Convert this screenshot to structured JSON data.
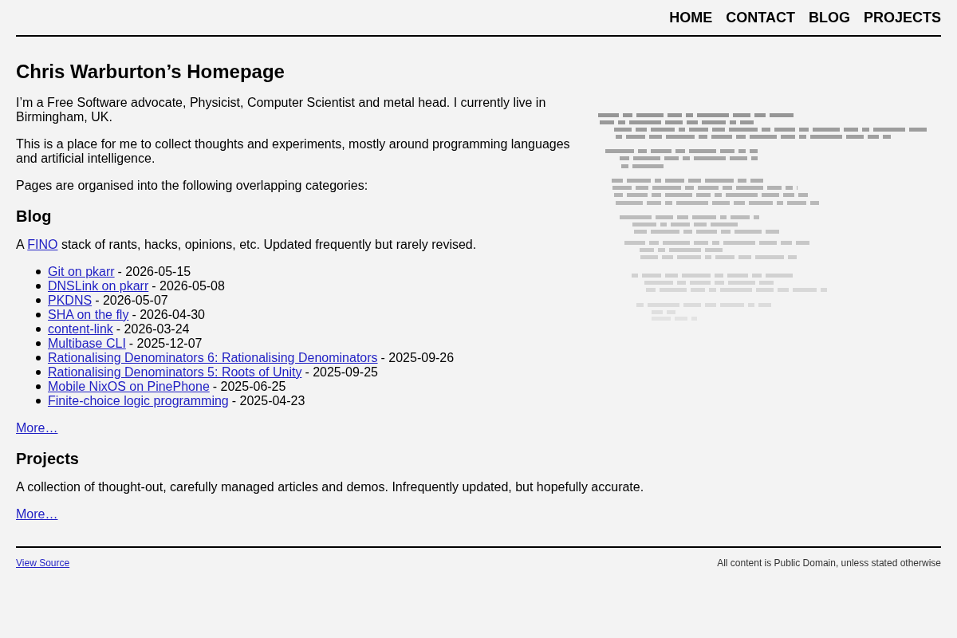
{
  "nav": [
    "HOME",
    "CONTACT",
    "BLOG",
    "PROJECTS"
  ],
  "title": "Chris Warburton’s Homepage",
  "intro": [
    "I’m a Free Software advocate, Physicist, Computer Scientist and metal head. I currently live in Birmingham, UK.",
    "This is a place for me to collect thoughts and experiments, mostly around programming languages and artificial intelligence.",
    "Pages are organised into the following overlapping categories:"
  ],
  "sections": [
    {
      "heading": "Blog",
      "description": [
        {
          "kind": "text",
          "text": "A"
        },
        {
          "kind": "link",
          "text": "FINO"
        },
        {
          "kind": "text",
          "text": "stack of rants, hacks, opinions, etc. Updated frequently but rarely revised."
        }
      ],
      "posts": [
        {
          "title": "Git on pkarr",
          "date": "- 2026-05-15"
        },
        {
          "title": "DNSLink on pkarr",
          "date": "- 2026-05-08"
        },
        {
          "title": "PKDNS",
          "date": "- 2026-05-07"
        },
        {
          "title": "SHA on the fly",
          "date": "- 2026-04-30"
        },
        {
          "title": "content-link",
          "date": "- 2026-03-24"
        },
        {
          "title": "Multibase CLI",
          "date": "- 2025-12-07"
        },
        {
          "title": "Rationalising Denominators 6: Rationalising Denominators",
          "date": "- 2025-09-26"
        },
        {
          "title": "Rationalising Denominators 5: Roots of Unity",
          "date": "- 2025-09-25"
        },
        {
          "title": "Mobile NixOS on PinePhone",
          "date": "- 2025-06-25"
        },
        {
          "title": "Finite-choice logic programming",
          "date": "- 2025-04-23"
        }
      ],
      "more": "More…"
    },
    {
      "heading": "Projects",
      "description": [
        {
          "kind": "text",
          "text": "A collection of thought-out, carefully managed articles and demos. Infrequently updated, but hopefully accurate."
        }
      ],
      "more": "More…"
    }
  ],
  "footer": {
    "link": "View Source",
    "notice": "All content is Public Domain, unless stated otherwise"
  }
}
